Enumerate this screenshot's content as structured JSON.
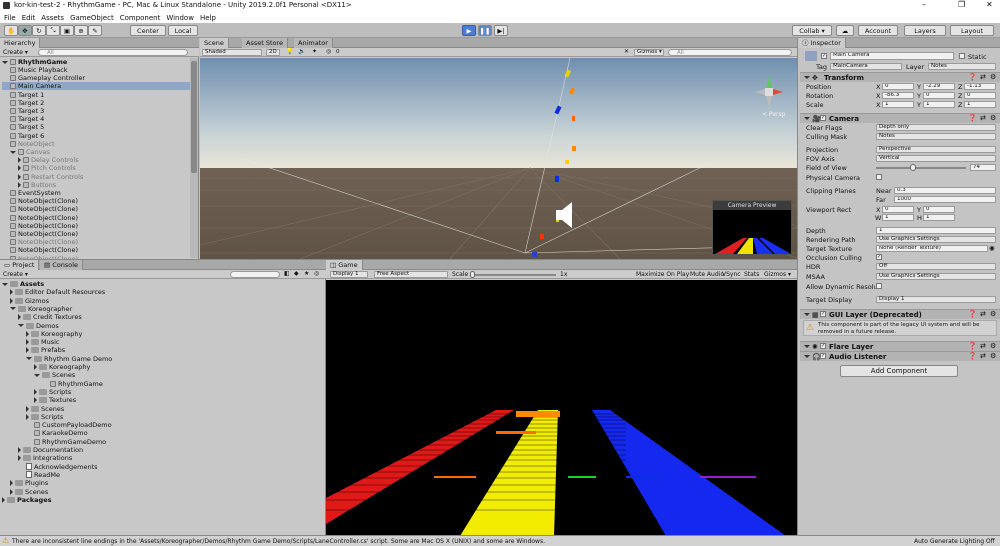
{
  "window": {
    "title": "kor-kin-test-2 - RhythmGame - PC, Mac & Linux Standalone - Unity 2019.2.0f1 Personal <DX11>",
    "min": "–",
    "max": "❐",
    "close": "✕"
  },
  "menu": [
    "File",
    "Edit",
    "Assets",
    "GameObject",
    "Component",
    "Window",
    "Help"
  ],
  "toolbar": {
    "center": "Center",
    "local": "Local",
    "collab": "Collab ▾",
    "account": "Account",
    "layers": "Layers",
    "layout": "Layout"
  },
  "hierarchy": {
    "tab": "Hierarchy",
    "create": "Create ▾",
    "search": "All",
    "scene": "RhythmGame",
    "items": [
      {
        "label": "Music Playback",
        "indent": 1,
        "grey": false,
        "sel": false
      },
      {
        "label": "Gameplay Controller",
        "indent": 1,
        "grey": false,
        "sel": false
      },
      {
        "label": "Main Camera",
        "indent": 1,
        "grey": false,
        "sel": true
      },
      {
        "label": "Target 1",
        "indent": 1,
        "grey": false,
        "sel": false
      },
      {
        "label": "Target 2",
        "indent": 1,
        "grey": false,
        "sel": false
      },
      {
        "label": "Target 3",
        "indent": 1,
        "grey": false,
        "sel": false
      },
      {
        "label": "Target 4",
        "indent": 1,
        "grey": false,
        "sel": false
      },
      {
        "label": "Target 5",
        "indent": 1,
        "grey": false,
        "sel": false
      },
      {
        "label": "Target 6",
        "indent": 1,
        "grey": false,
        "sel": false
      },
      {
        "label": "NoteObject",
        "indent": 1,
        "grey": true,
        "sel": false
      },
      {
        "label": "Canvas",
        "indent": 1,
        "grey": true,
        "sel": false,
        "fold": true
      },
      {
        "label": "Delay Controls",
        "indent": 2,
        "grey": true,
        "sel": false,
        "foldr": true
      },
      {
        "label": "Pitch Controls",
        "indent": 2,
        "grey": true,
        "sel": false,
        "foldr": true
      },
      {
        "label": "Restart Controls",
        "indent": 2,
        "grey": true,
        "sel": false,
        "foldr": true
      },
      {
        "label": "Buttons",
        "indent": 2,
        "grey": true,
        "sel": false,
        "foldr": true
      },
      {
        "label": "EventSystem",
        "indent": 1,
        "grey": false,
        "sel": false
      },
      {
        "label": "NoteObject(Clone)",
        "indent": 1,
        "grey": false,
        "sel": false
      },
      {
        "label": "NoteObject(Clone)",
        "indent": 1,
        "grey": false,
        "sel": false
      },
      {
        "label": "NoteObject(Clone)",
        "indent": 1,
        "grey": false,
        "sel": false
      },
      {
        "label": "NoteObject(Clone)",
        "indent": 1,
        "grey": false,
        "sel": false
      },
      {
        "label": "NoteObject(Clone)",
        "indent": 1,
        "grey": false,
        "sel": false
      },
      {
        "label": "NoteObject(Clone)",
        "indent": 1,
        "grey": true,
        "sel": false
      },
      {
        "label": "NoteObject(Clone)",
        "indent": 1,
        "grey": false,
        "sel": false
      },
      {
        "label": "NoteObject(Clone)",
        "indent": 1,
        "grey": true,
        "sel": false
      }
    ]
  },
  "scene": {
    "tabs": [
      "Scene",
      "Asset Store",
      "Animator"
    ],
    "shading": "Shaded",
    "mode2d": "2D",
    "gizmos": "Gizmos ▾",
    "search": "All",
    "persp": "< Persp",
    "camera_preview": "Camera Preview",
    "counter": "0"
  },
  "project": {
    "tabs": [
      "Project",
      "Console"
    ],
    "create": "Create ▾",
    "items": [
      {
        "label": "Assets",
        "indent": 0,
        "type": "folder",
        "fold": "open",
        "bold": true
      },
      {
        "label": "Editor Default Resources",
        "indent": 1,
        "type": "folder",
        "fold": "closed"
      },
      {
        "label": "Gizmos",
        "indent": 1,
        "type": "folder",
        "fold": "closed"
      },
      {
        "label": "Koreographer",
        "indent": 1,
        "type": "folder",
        "fold": "open"
      },
      {
        "label": "Credit Textures",
        "indent": 2,
        "type": "folder",
        "fold": "closed"
      },
      {
        "label": "Demos",
        "indent": 2,
        "type": "folder",
        "fold": "open"
      },
      {
        "label": "Koreography",
        "indent": 3,
        "type": "folder",
        "fold": "closed"
      },
      {
        "label": "Music",
        "indent": 3,
        "type": "folder",
        "fold": "closed"
      },
      {
        "label": "Prefabs",
        "indent": 3,
        "type": "folder",
        "fold": "closed"
      },
      {
        "label": "Rhythm Game Demo",
        "indent": 3,
        "type": "folder",
        "fold": "open"
      },
      {
        "label": "Koreography",
        "indent": 4,
        "type": "folder",
        "fold": "closed"
      },
      {
        "label": "Scenes",
        "indent": 4,
        "type": "folder",
        "fold": "open"
      },
      {
        "label": "RhythmGame",
        "indent": 5,
        "type": "unity",
        "fold": "none"
      },
      {
        "label": "Scripts",
        "indent": 4,
        "type": "folder",
        "fold": "closed"
      },
      {
        "label": "Textures",
        "indent": 4,
        "type": "folder",
        "fold": "closed"
      },
      {
        "label": "Scenes",
        "indent": 3,
        "type": "folder",
        "fold": "closed"
      },
      {
        "label": "Scripts",
        "indent": 3,
        "type": "folder",
        "fold": "closed"
      },
      {
        "label": "CustomPayloadDemo",
        "indent": 3,
        "type": "unity",
        "fold": "none"
      },
      {
        "label": "KaraokeDemo",
        "indent": 3,
        "type": "unity",
        "fold": "none"
      },
      {
        "label": "RhythmGameDemo",
        "indent": 3,
        "type": "unity",
        "fold": "none"
      },
      {
        "label": "Documentation",
        "indent": 2,
        "type": "folder",
        "fold": "closed"
      },
      {
        "label": "Integrations",
        "indent": 2,
        "type": "folder",
        "fold": "closed"
      },
      {
        "label": "Acknowledgements",
        "indent": 2,
        "type": "doc",
        "fold": "none"
      },
      {
        "label": "ReadMe",
        "indent": 2,
        "type": "doc",
        "fold": "none"
      },
      {
        "label": "Plugins",
        "indent": 1,
        "type": "folder",
        "fold": "closed"
      },
      {
        "label": "Scenes",
        "indent": 1,
        "type": "folder",
        "fold": "closed"
      },
      {
        "label": "Packages",
        "indent": 0,
        "type": "folder",
        "fold": "closed",
        "bold": true
      }
    ]
  },
  "game": {
    "tab": "Game",
    "display": "Display 1",
    "aspect": "Free Aspect",
    "scale_label": "Scale",
    "scale_value": "1x",
    "maximize": "Maximize On Play",
    "mute": "Mute Audio",
    "vsync": "VSync",
    "stats": "Stats",
    "gizmos": "Gizmos ▾"
  },
  "inspector": {
    "tab": "Inspector",
    "object_name": "Main Camera",
    "static": "Static",
    "tag_label": "Tag",
    "tag": "MainCamera",
    "layer_label": "Layer",
    "layer": "Notes",
    "transform": {
      "title": "Transform",
      "position": {
        "label": "Position",
        "x": "0",
        "y": "-2.29",
        "z": "-1.13"
      },
      "rotation": {
        "label": "Rotation",
        "x": "-86.3",
        "y": "0",
        "z": "0"
      },
      "scale": {
        "label": "Scale",
        "x": "1",
        "y": "1",
        "z": "1"
      }
    },
    "camera": {
      "title": "Camera",
      "clear_flags_label": "Clear Flags",
      "clear_flags": "Depth only",
      "culling_mask_label": "Culling Mask",
      "culling_mask": "Notes",
      "projection_label": "Projection",
      "projection": "Perspective",
      "fov_axis_label": "FOV Axis",
      "fov_axis": "Vertical",
      "fov_label": "Field of View",
      "fov": "74",
      "fov_fraction": 0.41,
      "physical_label": "Physical Camera",
      "clipping_label": "Clipping Planes",
      "near_label": "Near",
      "near": "0.3",
      "far_label": "Far",
      "far": "1000",
      "viewport_label": "Viewport Rect",
      "vp_x": "0",
      "vp_y": "0",
      "vp_w": "1",
      "vp_h": "1",
      "depth_label": "Depth",
      "depth": "1",
      "render_path_label": "Rendering Path",
      "render_path": "Use Graphics Settings",
      "target_tex_label": "Target Texture",
      "target_tex": "None (Render Texture)",
      "occlusion_label": "Occlusion Culling",
      "hdr_label": "HDR",
      "hdr": "Off",
      "msaa_label": "MSAA",
      "msaa": "Use Graphics Settings",
      "dyn_res_label": "Allow Dynamic Resoluti",
      "target_display_label": "Target Display",
      "target_display": "Display 1"
    },
    "gui_layer": {
      "title": "GUI Layer (Deprecated)",
      "warning": "This component is part of the legacy UI system and will be removed in a future release."
    },
    "flare_layer": {
      "title": "Flare Layer"
    },
    "audio_listener": {
      "title": "Audio Listener"
    },
    "add_component": "Add Component"
  },
  "status": {
    "message": "There are inconsistent line endings in the 'Assets/Koreographer/Demos/Rhythm Game Demo/Scripts/LaneController.cs' script. Some are Mac OS X (UNIX) and some are Windows.",
    "right": "Auto Generate Lighting Off"
  }
}
